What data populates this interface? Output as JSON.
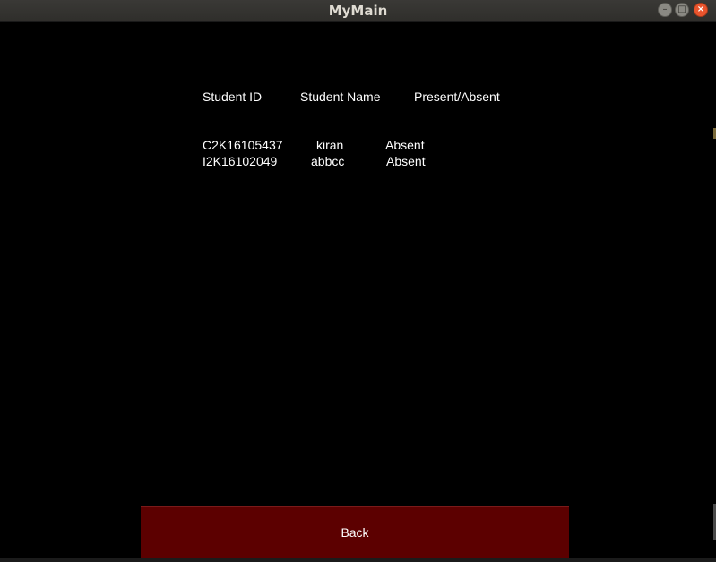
{
  "window": {
    "title": "MyMain"
  },
  "table": {
    "headers": [
      "Student ID",
      "Student Name",
      "Present/Absent"
    ],
    "rows": [
      {
        "id": "C2K16105437",
        "name": "kiran",
        "status": "Absent"
      },
      {
        "id": "I2K16102049",
        "name": "abbcc",
        "status": "Absent"
      }
    ]
  },
  "actions": {
    "back_label": "Back"
  },
  "colors": {
    "background": "#000000",
    "back_button": "#5c0000",
    "close_button": "#e9542d",
    "text": "#ffffff"
  }
}
